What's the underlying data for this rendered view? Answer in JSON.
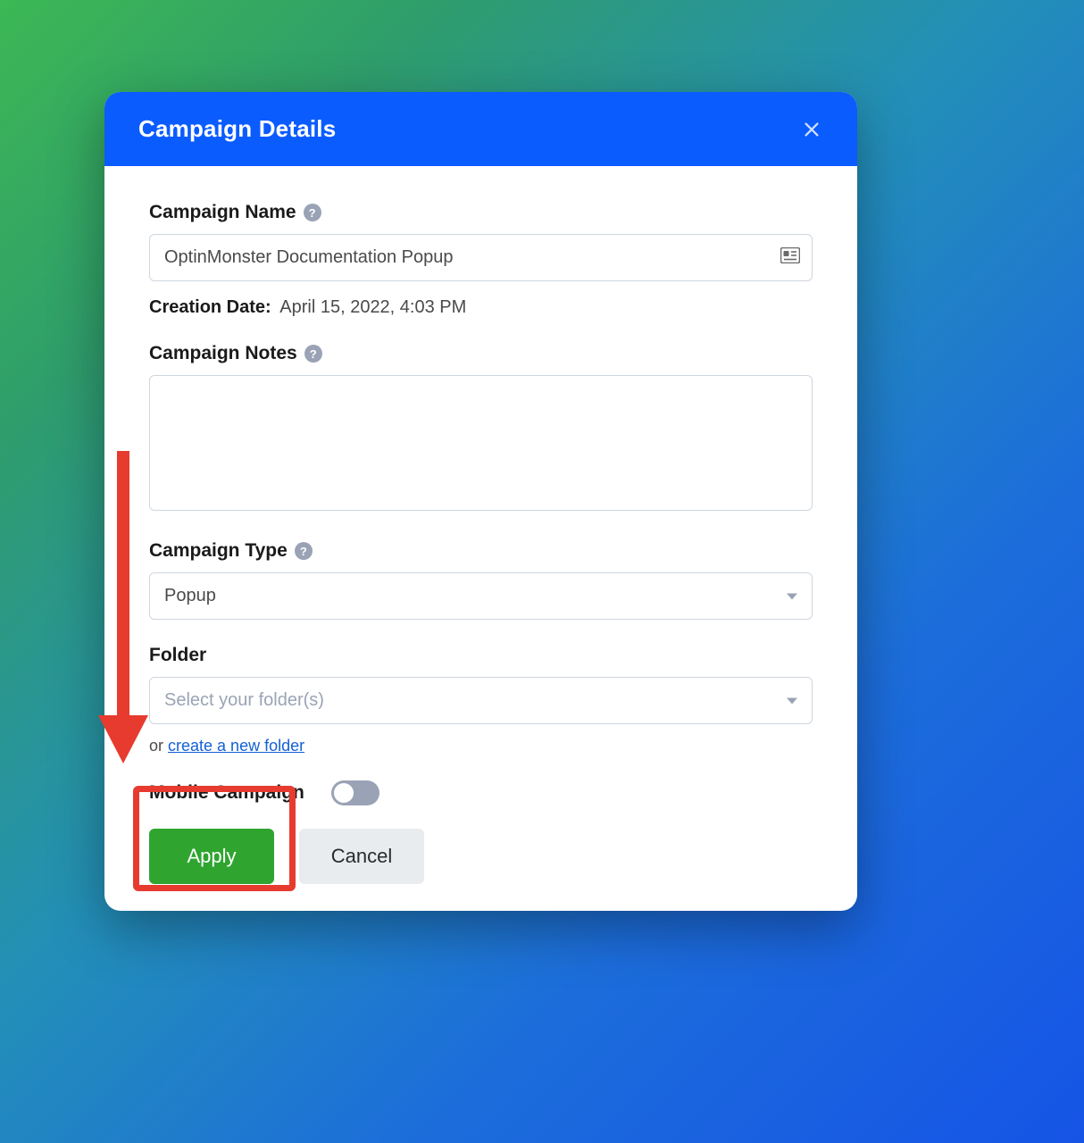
{
  "modal": {
    "title": "Campaign Details"
  },
  "fields": {
    "name_label": "Campaign Name",
    "name_value": "OptinMonster Documentation Popup",
    "creation_label": "Creation Date:",
    "creation_value": "April 15, 2022, 4:03 PM",
    "notes_label": "Campaign Notes",
    "notes_value": "",
    "type_label": "Campaign Type",
    "type_value": "Popup",
    "folder_label": "Folder",
    "folder_placeholder": "Select your folder(s)",
    "folder_hint_prefix": "or ",
    "folder_hint_link": "create a new folder",
    "mobile_label": "Mobile Campaign",
    "mobile_on": false
  },
  "buttons": {
    "apply": "Apply",
    "cancel": "Cancel"
  }
}
